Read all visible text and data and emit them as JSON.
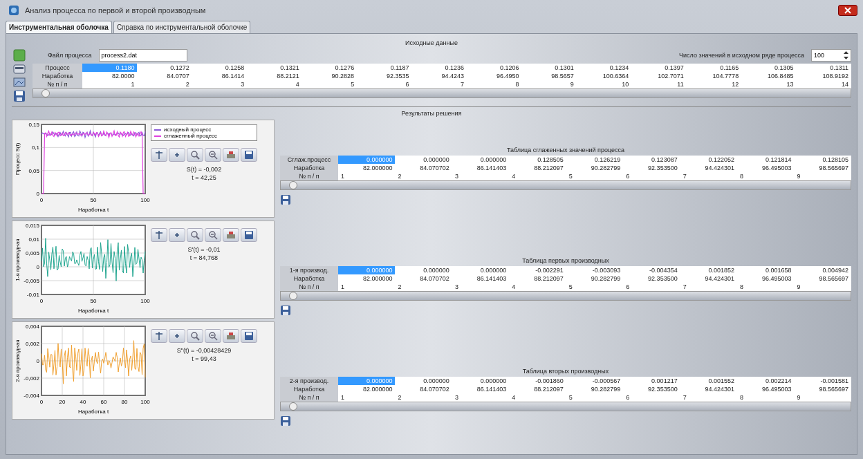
{
  "window": {
    "title": "Анализ процесса по первой и второй производным"
  },
  "tabs": [
    {
      "label": "Инструментальная оболочка",
      "selected": true
    },
    {
      "label": "Справка по инструментальной оболочке",
      "selected": false
    }
  ],
  "source_data": {
    "title": "Исходные данные",
    "file_label": "Файл процесса",
    "file_value": "process2.dat",
    "count_label": "Число значений в исходном ряде процесса",
    "count_value": "100",
    "rows": [
      {
        "label": "Процесс",
        "cells": [
          {
            "text": "0.1180",
            "selected": true
          },
          {
            "text": "0.1272",
            "selected": false
          },
          {
            "text": "0.1258",
            "selected": false
          },
          {
            "text": "0.1321",
            "selected": false
          },
          {
            "text": "0.1276",
            "selected": false
          },
          {
            "text": "0.1187",
            "selected": false
          },
          {
            "text": "0.1236",
            "selected": false
          },
          {
            "text": "0.1206",
            "selected": false
          },
          {
            "text": "0.1301",
            "selected": false
          },
          {
            "text": "0.1234",
            "selected": false
          },
          {
            "text": "0.1397",
            "selected": false
          },
          {
            "text": "0.1165",
            "selected": false
          },
          {
            "text": "0.1305",
            "selected": false
          },
          {
            "text": "0.1311",
            "selected": false
          }
        ]
      },
      {
        "label": "Наработка",
        "cells": [
          "82.0000",
          "84.0707",
          "86.1414",
          "88.2121",
          "90.2828",
          "92.3535",
          "94.4243",
          "96.4950",
          "98.5657",
          "100.6364",
          "102.7071",
          "104.7778",
          "106.8485",
          "108.9192"
        ]
      },
      {
        "label": "№ п / п",
        "cells": [
          "1",
          "2",
          "3",
          "4",
          "5",
          "6",
          "7",
          "8",
          "9",
          "10",
          "11",
          "12",
          "13",
          "14"
        ]
      }
    ]
  },
  "results": {
    "title": "Результаты решения",
    "charts": [
      {
        "kind": "process",
        "ylabel": "Процесс S(t)",
        "xlabel": "Наработка t",
        "yticks": [
          "0,15",
          "0,1",
          "0,05",
          "0"
        ],
        "xticks": [
          "0",
          "50",
          "100"
        ],
        "legend": [
          {
            "label": "исходный процесс",
            "color": "#8a5ad8"
          },
          {
            "label": "сглаженный процесс",
            "color": "#e040e0"
          }
        ],
        "readout": [
          "S(t) = -0,002",
          "t = 42,25"
        ]
      },
      {
        "kind": "derivative",
        "ylabel": "1-я производная",
        "xlabel": "Наработка t",
        "yticks": [
          "0,015",
          "0,01",
          "0,005",
          "0",
          "-0,005",
          "-0,01"
        ],
        "xticks": [
          "0",
          "50",
          "100"
        ],
        "color": "#1fa58f",
        "readout": [
          "S'(t) = -0,01",
          "t = 84,768"
        ]
      },
      {
        "kind": "derivative",
        "ylabel": "2-я производная",
        "xlabel": "Наработка t",
        "yticks": [
          "0,004",
          "0,002",
          "0",
          "-0,002",
          "-0,004"
        ],
        "xticks": [
          "0",
          "20",
          "40",
          "60",
          "80",
          "100"
        ],
        "color": "#f0a030",
        "readout": [
          "S''(t) = -0,00428429",
          "t = 99,43"
        ]
      }
    ],
    "tables": [
      {
        "title": "Таблица сглаженных значений процесса",
        "rows": [
          {
            "label": "Сглаж.процесс",
            "cells": [
              {
                "text": "0.000000",
                "selected": true
              },
              {
                "text": "0.000000",
                "selected": false
              },
              {
                "text": "0.000000",
                "selected": false
              },
              {
                "text": "0.128505",
                "selected": false
              },
              {
                "text": "0.126219",
                "selected": false
              },
              {
                "text": "0.123087",
                "selected": false
              },
              {
                "text": "0.122052",
                "selected": false
              },
              {
                "text": "0.121814",
                "selected": false
              },
              {
                "text": "0.128105",
                "selected": false
              }
            ]
          },
          {
            "label": "Наработка",
            "cells": [
              "82.000000",
              "84.070702",
              "86.141403",
              "88.212097",
              "90.282799",
              "92.353500",
              "94.424301",
              "96.495003",
              "98.565697"
            ]
          },
          {
            "label": "№ п / п",
            "cells": [
              "1",
              "2",
              "3",
              "4",
              "5",
              "6",
              "7",
              "8",
              "9"
            ]
          }
        ]
      },
      {
        "title": "Таблица первых производных",
        "rows": [
          {
            "label": "1-я производ.",
            "cells": [
              {
                "text": "0.000000",
                "selected": true
              },
              {
                "text": "0.000000",
                "selected": false
              },
              {
                "text": "0.000000",
                "selected": false
              },
              {
                "text": "-0.002291",
                "selected": false
              },
              {
                "text": "-0.003093",
                "selected": false
              },
              {
                "text": "-0.004354",
                "selected": false
              },
              {
                "text": "0.001852",
                "selected": false
              },
              {
                "text": "0.001658",
                "selected": false
              },
              {
                "text": "0.004942",
                "selected": false
              }
            ]
          },
          {
            "label": "Наработка",
            "cells": [
              "82.000000",
              "84.070702",
              "86.141403",
              "88.212097",
              "90.282799",
              "92.353500",
              "94.424301",
              "96.495003",
              "98.565697"
            ]
          },
          {
            "label": "№ п / п",
            "cells": [
              "1",
              "2",
              "3",
              "4",
              "5",
              "6",
              "7",
              "8",
              "9"
            ]
          }
        ]
      },
      {
        "title": "Таблица вторых производных",
        "rows": [
          {
            "label": "2-я производ.",
            "cells": [
              {
                "text": "0.000000",
                "selected": true
              },
              {
                "text": "0.000000",
                "selected": false
              },
              {
                "text": "0.000000",
                "selected": false
              },
              {
                "text": "-0.001860",
                "selected": false
              },
              {
                "text": "-0.000567",
                "selected": false
              },
              {
                "text": "0.001217",
                "selected": false
              },
              {
                "text": "0.001552",
                "selected": false
              },
              {
                "text": "0.002214",
                "selected": false
              },
              {
                "text": "-0.001581",
                "selected": false
              }
            ]
          },
          {
            "label": "Наработка",
            "cells": [
              "82.000000",
              "84.070702",
              "86.141403",
              "88.212097",
              "90.282799",
              "92.353500",
              "94.424301",
              "96.495003",
              "98.565697"
            ]
          },
          {
            "label": "№ п / п",
            "cells": [
              "1",
              "2",
              "3",
              "4",
              "5",
              "6",
              "7",
              "8",
              "9"
            ]
          }
        ]
      }
    ]
  }
}
